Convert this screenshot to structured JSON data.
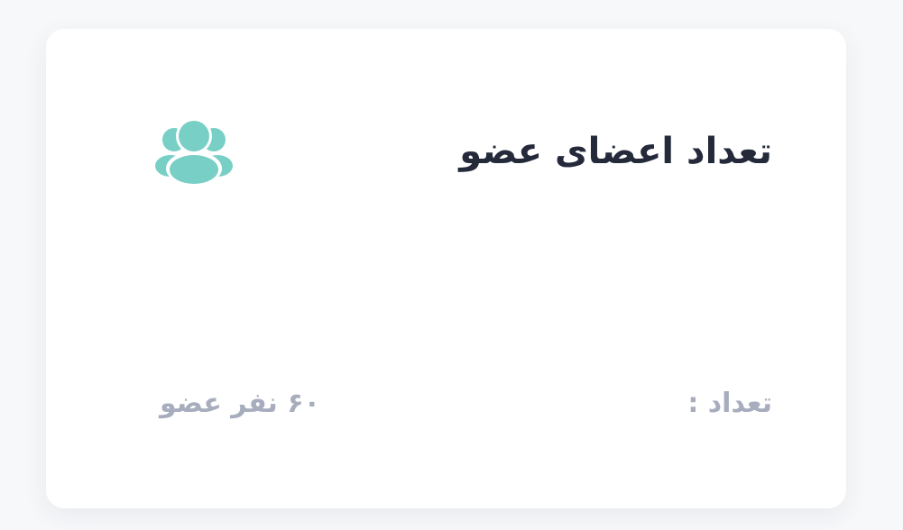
{
  "card": {
    "title": "تعداد اعضای عضو",
    "icon": "users-group-icon",
    "count_label": "تعداد :",
    "count_value": "۶۰ نفر عضو"
  },
  "colors": {
    "background": "#f7f8fa",
    "card": "#ffffff",
    "title": "#242a3a",
    "muted_text": "#a7adbd",
    "icon": "#78cfc6"
  }
}
